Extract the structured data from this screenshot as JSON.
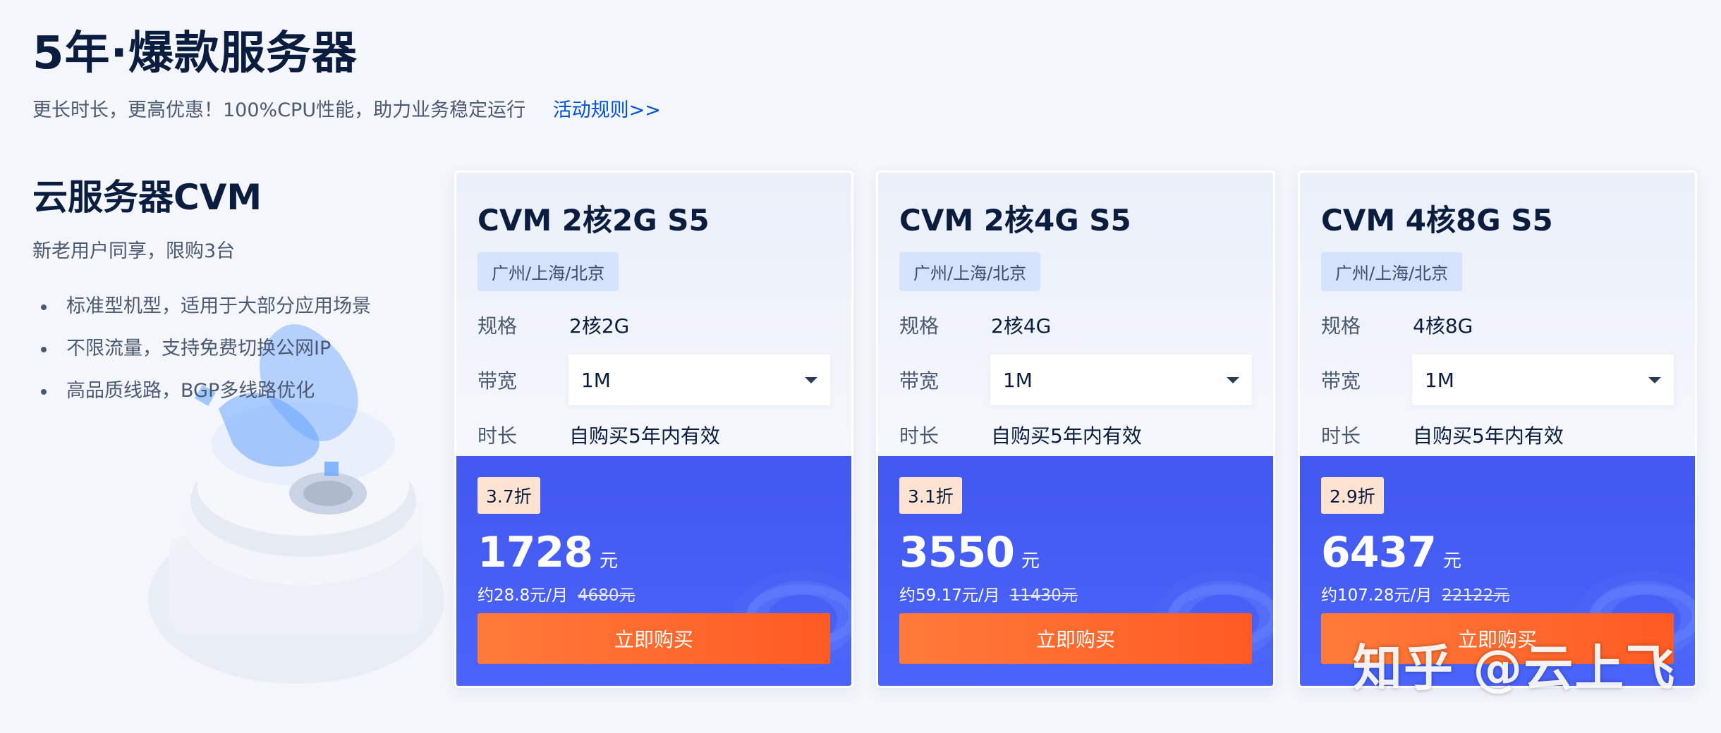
{
  "header": {
    "title": "5年·爆款服务器",
    "subtitle": "更长时长，更高优惠！100%CPU性能，助力业务稳定运行",
    "rules_link": "活动规则>>"
  },
  "intro": {
    "title": "云服务器CVM",
    "desc": "新老用户同享，限购3台",
    "features": [
      "标准型机型，适用于大部分应用场景",
      "不限流量，支持免费切换公网IP",
      "高品质线路，BGP多线路优化"
    ]
  },
  "labels": {
    "spec": "规格",
    "bandwidth": "带宽",
    "duration": "时长",
    "buy": "立即购买",
    "currency": "元"
  },
  "cards": [
    {
      "name": "CVM 2核2G S5",
      "region": "广州/上海/北京",
      "spec": "2核2G",
      "bandwidth": "1M",
      "duration": "自购买5年内有效",
      "discount": "3.7折",
      "price": "1728",
      "monthly": "约28.8元/月",
      "original": "4680元"
    },
    {
      "name": "CVM 2核4G S5",
      "region": "广州/上海/北京",
      "spec": "2核4G",
      "bandwidth": "1M",
      "duration": "自购买5年内有效",
      "discount": "3.1折",
      "price": "3550",
      "monthly": "约59.17元/月",
      "original": "11430元"
    },
    {
      "name": "CVM 4核8G S5",
      "region": "广州/上海/北京",
      "spec": "4核8G",
      "bandwidth": "1M",
      "duration": "自购买5年内有效",
      "discount": "2.9折",
      "price": "6437",
      "monthly": "约107.28元/月",
      "original": "22122元"
    }
  ],
  "watermark": "知乎 @云上飞",
  "colors": {
    "accent": "#0052d9",
    "card_price_bg": "#4a64fb",
    "buy_button": "#ff5a22",
    "discount_badge": "#ffe3d2"
  }
}
